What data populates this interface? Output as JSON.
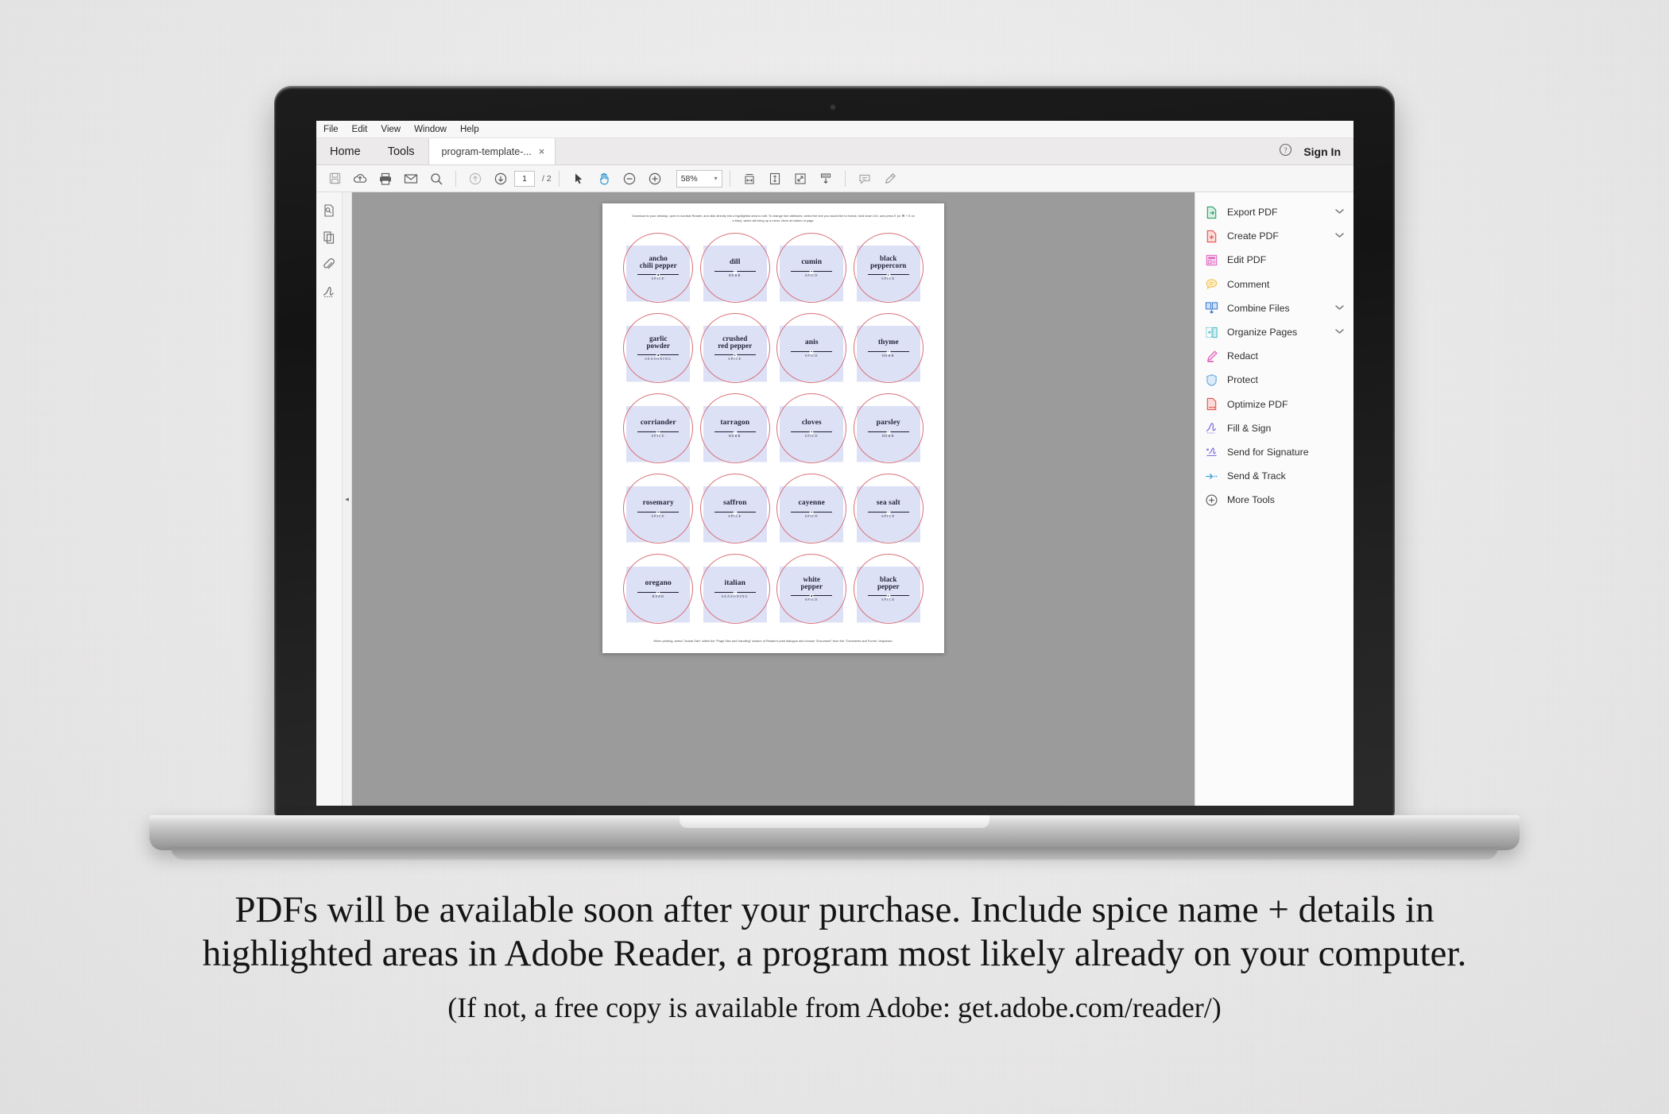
{
  "app": {
    "menubar": [
      "File",
      "Edit",
      "View",
      "Window",
      "Help"
    ],
    "tabs": {
      "home": "Home",
      "tools": "Tools",
      "document": "program-template-...",
      "close_glyph": "×"
    },
    "account": {
      "help_icon": "help-circle-icon",
      "sign_in": "Sign In"
    },
    "toolbar": {
      "save_icon": "save-icon",
      "cloud_icon": "upload-to-cloud-icon",
      "print_icon": "print-icon",
      "email_icon": "email-icon",
      "search_icon": "search-icon",
      "prev_page_icon": "previous-page-icon",
      "next_page_icon": "next-page-icon",
      "page_current": "1",
      "page_total": "/ 2",
      "select_icon": "select-cursor-icon",
      "hand_icon": "hand-tool-icon",
      "zoom_out_icon": "zoom-out-icon",
      "zoom_in_icon": "zoom-in-icon",
      "zoom_value": "58%",
      "zoom_caret": "▾",
      "fit_width_icon": "fit-width-icon",
      "fit_page_icon": "fit-page-icon",
      "fullscreen_icon": "fullscreen-icon",
      "scroll_mode_icon": "scroll-mode-icon",
      "comment_icon": "comment-bubble-icon",
      "highlight_icon": "highlight-marker-icon"
    },
    "left_rail": [
      {
        "name": "page-thumbnails-icon"
      },
      {
        "name": "pages-copy-icon"
      },
      {
        "name": "attachments-clip-icon"
      },
      {
        "name": "signatures-icon"
      }
    ],
    "collapse_arrow": "◂"
  },
  "tools_panel": {
    "items": [
      {
        "label": "Export PDF",
        "icon": "export-pdf-icon",
        "color": "#2e9e6b",
        "chevron": "⌃"
      },
      {
        "label": "Create PDF",
        "icon": "create-pdf-icon",
        "color": "#e2574c",
        "chevron": "⌃"
      },
      {
        "label": "Edit PDF",
        "icon": "edit-pdf-icon",
        "color": "#e06cc2",
        "chevron": ""
      },
      {
        "label": "Comment",
        "icon": "comment-icon",
        "color": "#f2c14a",
        "chevron": ""
      },
      {
        "label": "Combine Files",
        "icon": "combine-files-icon",
        "color": "#3c7ad1",
        "chevron": "⌃"
      },
      {
        "label": "Organize Pages",
        "icon": "organize-pages-icon",
        "color": "#45bcc4",
        "chevron": "⌃"
      },
      {
        "label": "Redact",
        "icon": "redact-icon",
        "color": "#e05bb4",
        "chevron": ""
      },
      {
        "label": "Protect",
        "icon": "protect-shield-icon",
        "color": "#6aa9dd",
        "chevron": ""
      },
      {
        "label": "Optimize PDF",
        "icon": "optimize-pdf-icon",
        "color": "#e2574c",
        "chevron": ""
      },
      {
        "label": "Fill & Sign",
        "icon": "fill-and-sign-icon",
        "color": "#7b6bdd",
        "chevron": ""
      },
      {
        "label": "Send for Signature",
        "icon": "send-for-signature-icon",
        "color": "#7b6bdd",
        "chevron": ""
      },
      {
        "label": "Send & Track",
        "icon": "send-and-track-icon",
        "color": "#3aa0d8",
        "chevron": ""
      },
      {
        "label": "More Tools",
        "icon": "more-tools-icon",
        "color": "#5a5a5a",
        "chevron": ""
      }
    ]
  },
  "document": {
    "header_note": "Download to your desktop, open in Acrobat Reader, and click directly into a highlighted area to edit. To change font attributes, select the text you would like to format, hold down Ctrl, and press E (or ⌘ + E on a Mac), which will bring up a menu.  More at bottom of page.",
    "footer_note": "When printing, select \"Actual Size\" within the \"Page Size and Handling\" section of Reader's print dialogue and choose \"Document\" from the \"Comments and Forms\" dropdown.",
    "labels": [
      {
        "name": "ancho\nchili pepper",
        "category": "SPICE"
      },
      {
        "name": "dill",
        "category": "HERB"
      },
      {
        "name": "cumin",
        "category": "SPICE"
      },
      {
        "name": "black\npeppercorn",
        "category": "SPICE"
      },
      {
        "name": "garlic\npowder",
        "category": "SEASONING"
      },
      {
        "name": "crushed\nred pepper",
        "category": "SPICE"
      },
      {
        "name": "anis",
        "category": "SPICE"
      },
      {
        "name": "thyme",
        "category": "HERB"
      },
      {
        "name": "corriander",
        "category": "SPICE"
      },
      {
        "name": "tarragon",
        "category": "HERB"
      },
      {
        "name": "cloves",
        "category": "SPICE"
      },
      {
        "name": "parsley",
        "category": "HERB"
      },
      {
        "name": "rosemary",
        "category": "SPICE"
      },
      {
        "name": "saffron",
        "category": "SPICE"
      },
      {
        "name": "cayenne",
        "category": "SPICE"
      },
      {
        "name": "sea salt",
        "category": "SPICE"
      },
      {
        "name": "oregano",
        "category": "HERB"
      },
      {
        "name": "italian",
        "category": "SEASONING"
      },
      {
        "name": "white\npepper",
        "category": "SPICE"
      },
      {
        "name": "black\npepper",
        "category": "SPICE"
      }
    ],
    "colors": {
      "field_highlight": "#dde1f6",
      "circle_outline": "#d9717a",
      "text": "#23253c"
    }
  },
  "caption": {
    "line1": "PDFs will be available soon after your purchase. Include spice name + details in",
    "line2": "highlighted areas in Adobe Reader, a program most likely already on your computer.",
    "line3": "(If not, a free copy is available from Adobe: get.adobe.com/reader/)"
  }
}
